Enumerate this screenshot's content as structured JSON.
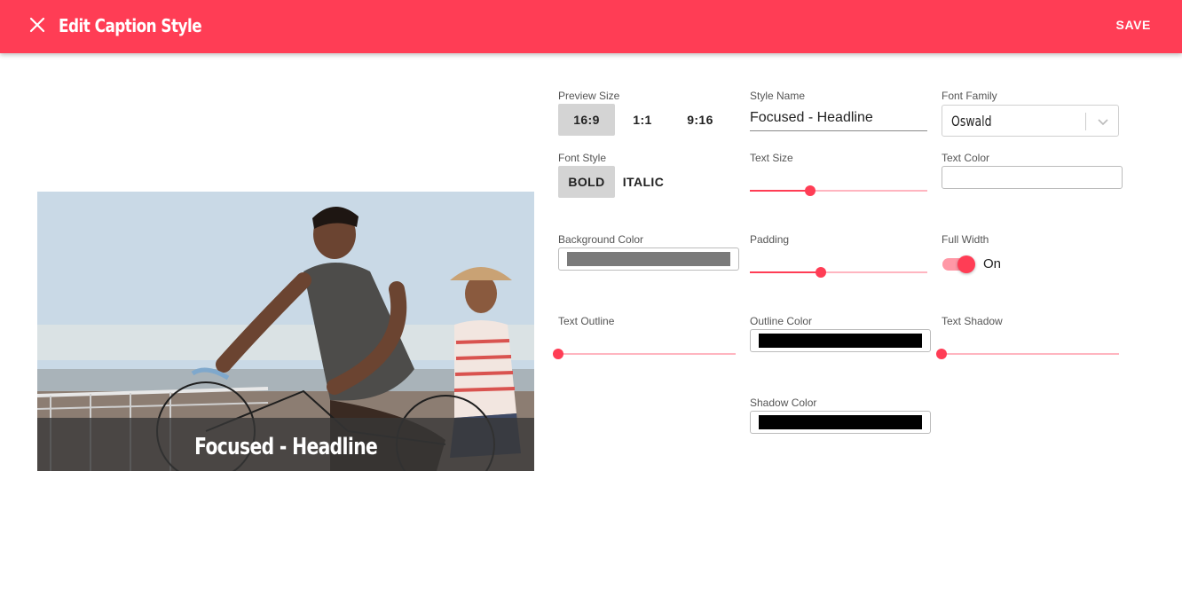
{
  "header": {
    "title": "Edit Caption Style",
    "save_label": "SAVE"
  },
  "preview": {
    "caption_text": "Focused - Headline"
  },
  "preview_size": {
    "label": "Preview Size",
    "options": [
      "16:9",
      "1:1",
      "9:16"
    ],
    "selected": "16:9"
  },
  "style_name": {
    "label": "Style Name",
    "value": "Focused - Headline"
  },
  "font_family": {
    "label": "Font Family",
    "value": "Oswald"
  },
  "font_style": {
    "label": "Font Style",
    "options": [
      "BOLD",
      "ITALIC"
    ],
    "selected": "BOLD"
  },
  "text_size": {
    "label": "Text Size",
    "value_fraction": 0.34
  },
  "text_color": {
    "label": "Text Color",
    "value": "#ffffff"
  },
  "background_color": {
    "label": "Background Color",
    "value": "#7a7a7a"
  },
  "padding": {
    "label": "Padding",
    "value_fraction": 0.4
  },
  "full_width": {
    "label": "Full Width",
    "state_label": "On",
    "on": true
  },
  "text_outline": {
    "label": "Text Outline",
    "value_fraction": 0.0
  },
  "outline_color": {
    "label": "Outline Color",
    "value": "#000000"
  },
  "text_shadow": {
    "label": "Text Shadow",
    "value_fraction": 0.0
  },
  "shadow_color": {
    "label": "Shadow Color",
    "value": "#000000"
  },
  "colors": {
    "accent": "#ff3d55",
    "accent_light": "#ffb5c0",
    "selected_bg": "#d4d4d4"
  }
}
